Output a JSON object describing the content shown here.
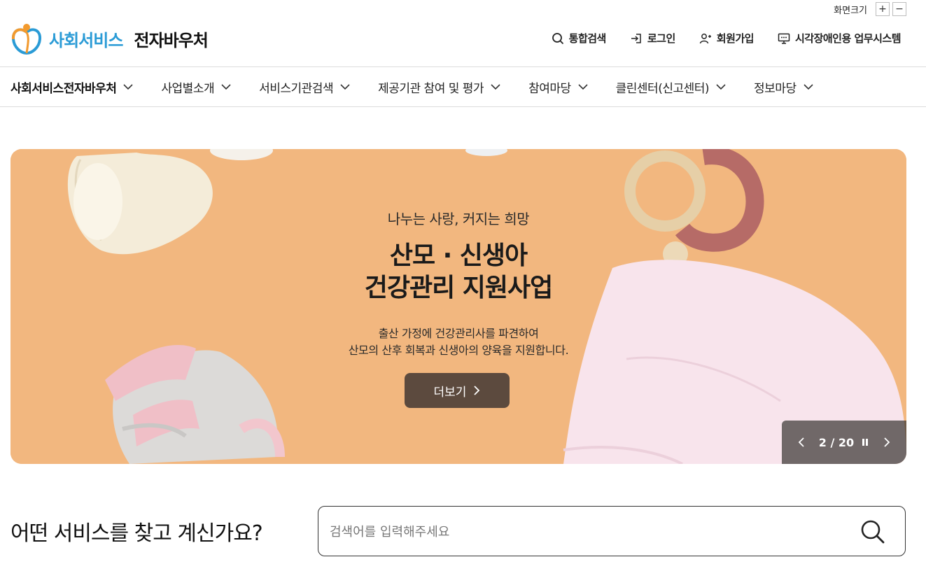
{
  "font_size": {
    "label": "화면크기",
    "plus": "+",
    "minus": "−"
  },
  "header": {
    "logo_part1": "사회서비스",
    "logo_part2": "전자바우처",
    "utils": [
      {
        "label": "통합검색",
        "icon": "search-icon"
      },
      {
        "label": "로그인",
        "icon": "login-icon"
      },
      {
        "label": "회원가입",
        "icon": "user-add-icon"
      },
      {
        "label": "시각장애인용 업무시스템",
        "icon": "monitor-icon"
      }
    ]
  },
  "nav": {
    "items": [
      "사회서비스전자바우처",
      "사업별소개",
      "서비스기관검색",
      "제공기관 참여 및 평가",
      "참여마당",
      "클린센터(신고센터)",
      "정보마당"
    ]
  },
  "banner": {
    "subtitle": "나누는 사랑, 커지는 희망",
    "title_line1": "산모 · 신생아",
    "title_line2": "건강관리 지원사업",
    "desc_line1": "출산 가정에 건강관리사를 파견하여",
    "desc_line2": "산모의 산후 회복과 신생아의 양육을 지원합니다.",
    "more_label": "더보기",
    "pager": "2 / 20"
  },
  "search": {
    "question": "어떤 서비스를 찾고 계신가요?",
    "placeholder": "검색어를 입력해주세요"
  },
  "colors": {
    "brand_blue": "#2a9bd6",
    "banner_bg": "#f2b77f",
    "button_brown": "#5c4a3e"
  }
}
